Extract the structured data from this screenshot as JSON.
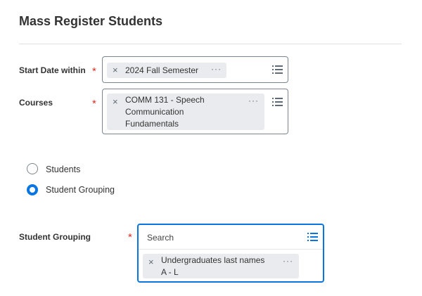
{
  "page": {
    "title": "Mass Register Students"
  },
  "fields": {
    "start_date": {
      "label": "Start Date within",
      "required_mark": "*",
      "selected": "2024 Fall Semester",
      "remove": "×",
      "more": "···"
    },
    "courses": {
      "label": "Courses",
      "required_mark": "*",
      "selected_lines": [
        "COMM 131 - Speech",
        "Communication",
        "Fundamentals"
      ],
      "remove": "×",
      "more": "···"
    },
    "student_grouping": {
      "label": "Student Grouping",
      "required_mark": "*",
      "placeholder": "Search",
      "selected_lines": [
        "Undergraduates last names",
        "A - L"
      ],
      "remove": "×",
      "more": "···"
    }
  },
  "register_by": {
    "options": [
      {
        "label": "Students",
        "selected": false
      },
      {
        "label": "Student Grouping",
        "selected": true
      }
    ]
  },
  "icons": {
    "prompt": "list-prompt-icon",
    "remove": "close-icon",
    "more": "more-options-icon"
  },
  "colors": {
    "accent": "#0875e1",
    "required": "#de2e21",
    "pill_bg": "#e9ebee",
    "border": "#7b858f"
  }
}
